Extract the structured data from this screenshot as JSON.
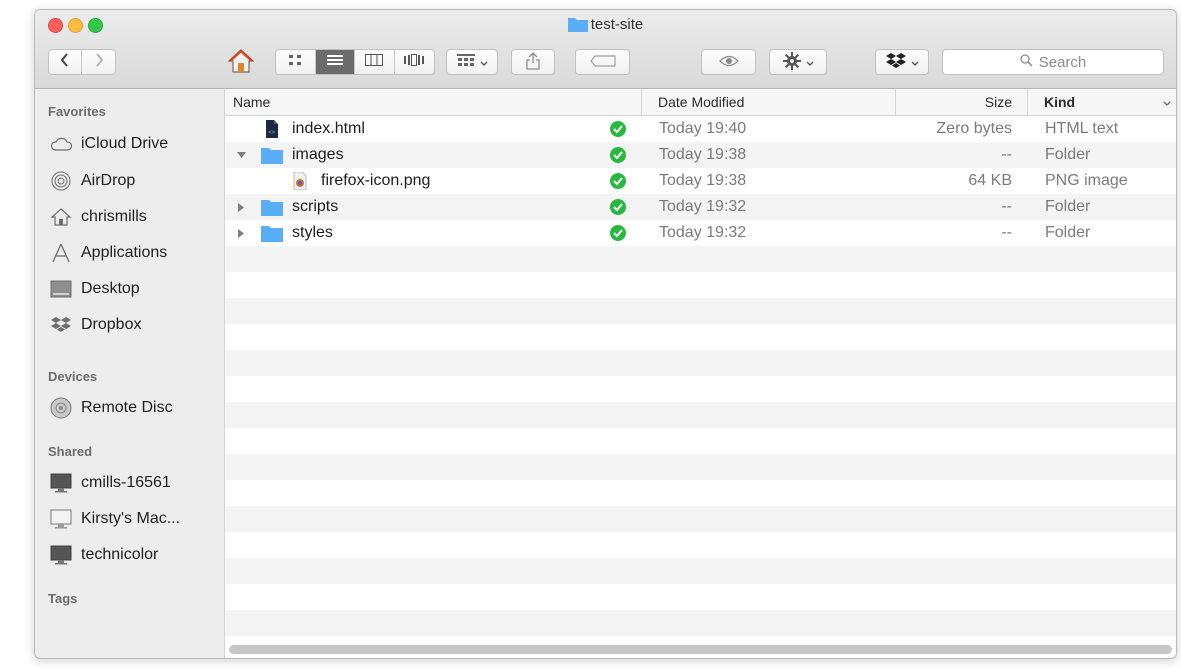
{
  "window": {
    "title": "test-site"
  },
  "toolbar": {
    "back_icon": "chevron-left-icon",
    "forward_icon": "chevron-right-icon",
    "home_icon": "home-icon",
    "view_buttons": [
      "icon-view-icon",
      "list-view-icon",
      "column-view-icon",
      "cover-flow-icon"
    ],
    "active_view": "list-view-icon",
    "arrange_icon": "arrange-icon",
    "share_icon": "share-icon",
    "tag_icon": "tag-icon",
    "quicklook_icon": "eye-icon",
    "action_icon": "gear-icon",
    "dropbox_icon": "dropbox-icon",
    "search_placeholder": "Search"
  },
  "sidebar": {
    "sections": [
      {
        "title": "Favorites",
        "items": [
          {
            "label": "iCloud Drive",
            "icon": "cloud-icon"
          },
          {
            "label": "AirDrop",
            "icon": "airdrop-icon"
          },
          {
            "label": "chrismills",
            "icon": "home-folder-icon"
          },
          {
            "label": "Applications",
            "icon": "applications-icon"
          },
          {
            "label": "Desktop",
            "icon": "desktop-icon"
          },
          {
            "label": "Dropbox",
            "icon": "dropbox-icon"
          }
        ]
      },
      {
        "title": "Devices",
        "items": [
          {
            "label": "Remote Disc",
            "icon": "disc-icon"
          }
        ]
      },
      {
        "title": "Shared",
        "items": [
          {
            "label": "cmills-16561",
            "icon": "computer-icon"
          },
          {
            "label": "Kirsty's Mac...",
            "icon": "computer-icon"
          },
          {
            "label": "technicolor",
            "icon": "computer-icon"
          }
        ]
      },
      {
        "title": "Tags",
        "items": []
      }
    ]
  },
  "columns": {
    "name": "Name",
    "date": "Date Modified",
    "size": "Size",
    "kind": "Kind"
  },
  "files": [
    {
      "name": "index.html",
      "date": "Today 19:40",
      "size": "Zero bytes",
      "kind": "HTML text",
      "icon": "html-file-icon",
      "disclosure": "none",
      "indent": 0,
      "synced": true
    },
    {
      "name": "images",
      "date": "Today 19:38",
      "size": "--",
      "kind": "Folder",
      "icon": "folder-icon",
      "disclosure": "expanded",
      "indent": 0,
      "synced": true
    },
    {
      "name": "firefox-icon.png",
      "date": "Today 19:38",
      "size": "64 KB",
      "kind": "PNG image",
      "icon": "png-file-icon",
      "disclosure": "none",
      "indent": 1,
      "synced": true
    },
    {
      "name": "scripts",
      "date": "Today 19:32",
      "size": "--",
      "kind": "Folder",
      "icon": "folder-icon",
      "disclosure": "collapsed",
      "indent": 0,
      "synced": true
    },
    {
      "name": "styles",
      "date": "Today 19:32",
      "size": "--",
      "kind": "Folder",
      "icon": "folder-icon",
      "disclosure": "collapsed",
      "indent": 0,
      "synced": true
    }
  ],
  "colors": {
    "folder_blue": "#5aaef5",
    "sync_green": "#28b840",
    "close": "#fc605c",
    "minimize": "#fdbc40",
    "zoom": "#34c84a"
  }
}
